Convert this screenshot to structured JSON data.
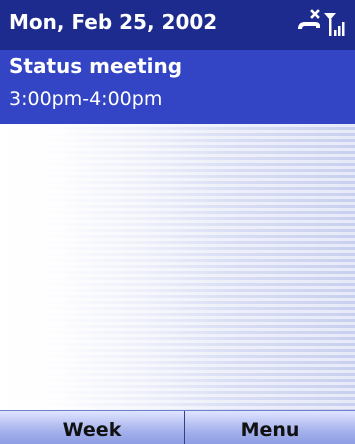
{
  "titlebar": {
    "date": "Mon, Feb 25, 2002",
    "icons": [
      "phone-off-icon",
      "signal-strength-icon"
    ]
  },
  "appointment": {
    "title": "Status meeting",
    "time": "3:00pm-4:00pm"
  },
  "softkeys": {
    "left_label": "Week",
    "right_label": "Menu"
  },
  "colors": {
    "titlebar_bg": "#1d2b8f",
    "appointment_bg": "#3344c4",
    "softkey_bg": "#a6b2ec"
  }
}
